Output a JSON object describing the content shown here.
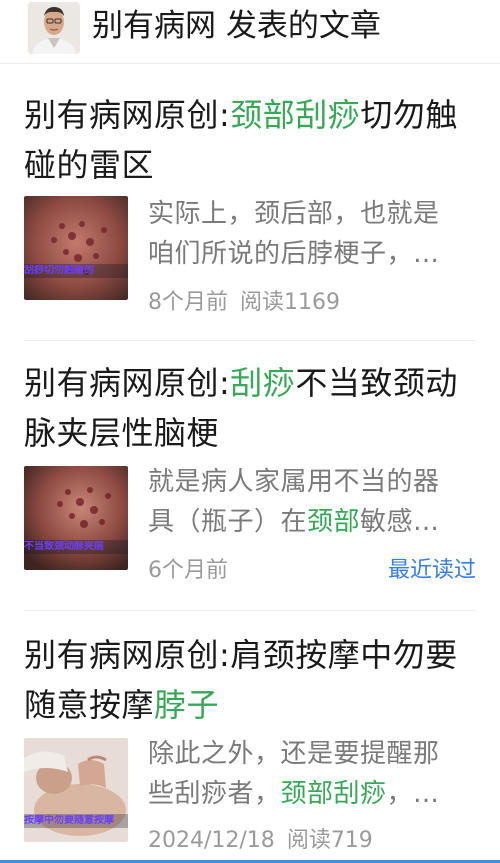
{
  "header": {
    "title": "别有病网 发表的文章"
  },
  "articles": [
    {
      "title_prefix": "别有病网原创:",
      "title_highlight": "颈部刮痧",
      "title_suffix": "切勿触碰的雷区",
      "thumb_caption": "刮痧切勿触碰的",
      "excerpt_line1": "实际上，颈后部，也就是",
      "excerpt_line2": "咱们所说的后脖梗子，…",
      "time": "8个月前",
      "reads": "阅读1169"
    },
    {
      "title_prefix": "别有病网原创:",
      "title_highlight": "刮痧",
      "title_suffix": "不当致颈动脉夹层性脑梗",
      "thumb_caption": "不当致颈动脉夹层",
      "excerpt_line1": "就是病人家属用不当的器",
      "excerpt_line2_prefix": "具（瓶子）在",
      "excerpt_line2_highlight": "颈部",
      "excerpt_line2_suffix": "敏感…",
      "time": "6个月前",
      "recent_read": "最近读过"
    },
    {
      "title_prefix": "别有病网原创:肩颈按摩中勿要随意按摩",
      "title_highlight": "脖子",
      "thumb_caption": "按摩中勿要随意按摩",
      "excerpt_line1": "除此之外，还是要提醒那",
      "excerpt_line2_prefix": "些刮痧者，",
      "excerpt_line2_highlight": "颈部刮痧",
      "excerpt_line2_suffix": "，…",
      "time": "2024/12/18",
      "reads": "阅读719"
    }
  ]
}
